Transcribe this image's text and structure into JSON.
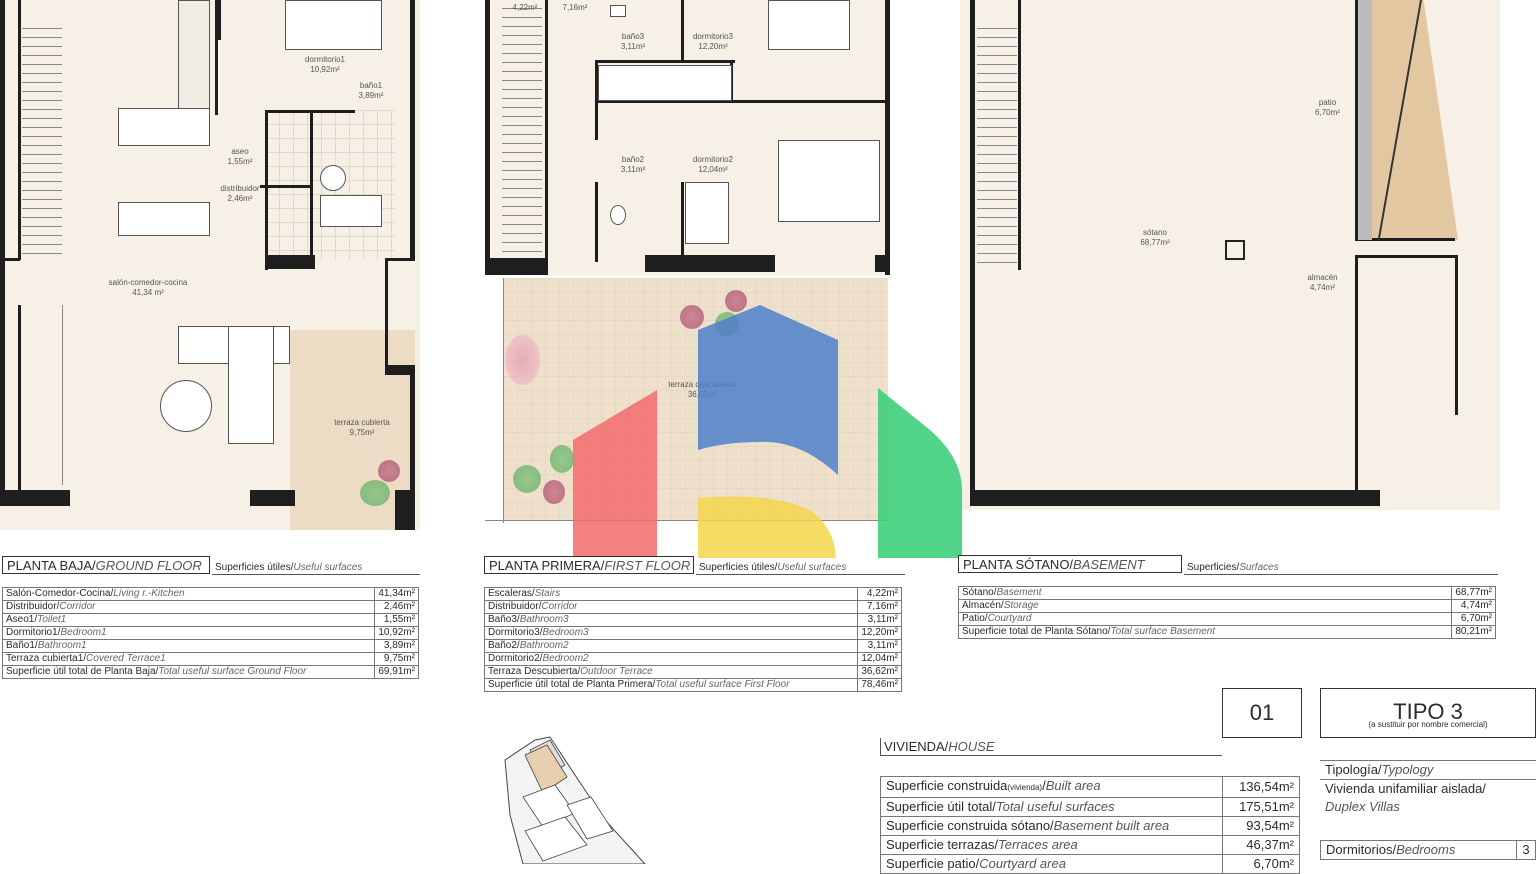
{
  "ground_floor": {
    "title": "PLANTA BAJA/",
    "title_en": "GROUND FLOOR",
    "subtitle": "Superficies útiles/",
    "subtitle_en": "Useful surfaces",
    "rooms": {
      "dormitorio1": [
        "dormitorio1",
        "10,92m²"
      ],
      "bano1": [
        "baño1",
        "3,89m²"
      ],
      "aseo": [
        "aseo",
        "1,55m²"
      ],
      "distribuidor": [
        "distribuidor",
        "2,46m²"
      ],
      "salon": [
        "salón-comedor-cocina",
        "41,34 m²"
      ],
      "terraza": [
        "terraza cubierta",
        "9,75m²"
      ]
    },
    "rows": [
      {
        "es": "Salón-Comedor-Cocina/",
        "en": "Living r.-Kitchen",
        "value": "41,34m²"
      },
      {
        "es": "Distribuidor/",
        "en": "Corridor",
        "value": "2,46m²"
      },
      {
        "es": "Aseo1/",
        "en": "Toilet1",
        "value": "1,55m²"
      },
      {
        "es": "Dormitorio1/",
        "en": "Bedroom1",
        "value": "10,92m²"
      },
      {
        "es": "Baño1/",
        "en": "Bathroom1",
        "value": "3,89m²"
      },
      {
        "es": "Terraza cubierta1/",
        "en": "Covered Terrace1",
        "value": "9,75m²"
      },
      {
        "es": "Superficie útil total de Planta Baja/",
        "en": "Total useful surface Ground Floor",
        "value": "69,91m²"
      }
    ]
  },
  "first_floor": {
    "title": "PLANTA PRIMERA/",
    "title_en": "FIRST FLOOR",
    "subtitle": "Superficies útiles/",
    "subtitle_en": "Useful surfaces",
    "rooms": {
      "top1": "4,22m²",
      "top2": "7,16m²",
      "bano3": [
        "baño3",
        "3,11m²"
      ],
      "dormitorio3": [
        "dormitorio3",
        "12,20m²"
      ],
      "bano2": [
        "baño2",
        "3,11m²"
      ],
      "dormitorio2": [
        "dormitorio2",
        "12,04m²"
      ],
      "terraza": [
        "terraza descubierta",
        "36,62m²"
      ]
    },
    "rows": [
      {
        "es": "Escaleras/",
        "en": "Stairs",
        "value": "4,22m²"
      },
      {
        "es": "Distribuidor/",
        "en": "Corridor",
        "value": "7,16m²"
      },
      {
        "es": "Baño3/",
        "en": "Bathroom3",
        "value": "3,11m²"
      },
      {
        "es": "Dormitorio3/",
        "en": "Bedroom3",
        "value": "12,20m²"
      },
      {
        "es": "Baño2/",
        "en": "Bathroom2",
        "value": "3,11m²"
      },
      {
        "es": "Dormitorio2/",
        "en": "Bedroom2",
        "value": "12,04m²"
      },
      {
        "es": "Terraza Descubierta/",
        "en": "Outdoor Terrace",
        "value": "36,62m²"
      },
      {
        "es": "Superficie útil total de Planta Primera/",
        "en": "Total useful surface First Floor",
        "value": "78,46m²"
      }
    ]
  },
  "basement": {
    "title": "PLANTA SÓTANO/",
    "title_en": "BASEMENT",
    "subtitle": "Superficies/",
    "subtitle_en": "Surfaces",
    "rooms": {
      "patio": [
        "patio",
        "6,70m²"
      ],
      "sotano": [
        "sótano",
        "68,77m²"
      ],
      "almacen": [
        "almacén",
        "4,74m²"
      ]
    },
    "rows": [
      {
        "es": "Sótano/",
        "en": "Basement",
        "value": "68,77m²"
      },
      {
        "es": "Almacén/",
        "en": "Storage",
        "value": "4,74m²"
      },
      {
        "es": "Patio/",
        "en": "Courtyard",
        "value": "6,70m²"
      },
      {
        "es": "Superficie total de Planta Sótano/",
        "en": "Total surface Basement",
        "value": "80,21m²"
      }
    ]
  },
  "house": {
    "number": "01",
    "tipo": "TIPO 3",
    "tipo_note": "(a sustituir por nombre comercial)",
    "label": "VIVIENDA/",
    "label_en": "HOUSE",
    "rows": [
      {
        "es": "Superficie construida",
        "small": "(vivienda)",
        "en": "Built area",
        "value": "136,54m²"
      },
      {
        "es": "Superficie útil total/",
        "small": "",
        "en": "Total useful surfaces",
        "value": "175,51m²"
      },
      {
        "es": "Superficie construida sótano/",
        "small": "",
        "en": "Basement built area",
        "value": "93,54m²"
      },
      {
        "es": "Superficie terrazas/",
        "small": "",
        "en": "Terraces area",
        "value": "46,37m²"
      },
      {
        "es": "Superficie patio/",
        "small": "",
        "en": "Courtyard area",
        "value": "6,70m²"
      }
    ],
    "tipologia": "Tipología/",
    "tipologia_en": "Typology",
    "tipologia_value": "Vivienda unifamiliar aislada/",
    "tipologia_value_en": "Duplex Villas",
    "bedrooms_label": "Dormitorios/",
    "bedrooms_label_en": "Bedrooms",
    "bedrooms_value": "3"
  },
  "colors": {
    "floor": "#f6f0e6",
    "wall": "#1e1e1e",
    "logo_red": "#f26b6b",
    "logo_blue": "#4d7fc9",
    "logo_yellow": "#f5d54a",
    "logo_green": "#3ecf7a"
  }
}
